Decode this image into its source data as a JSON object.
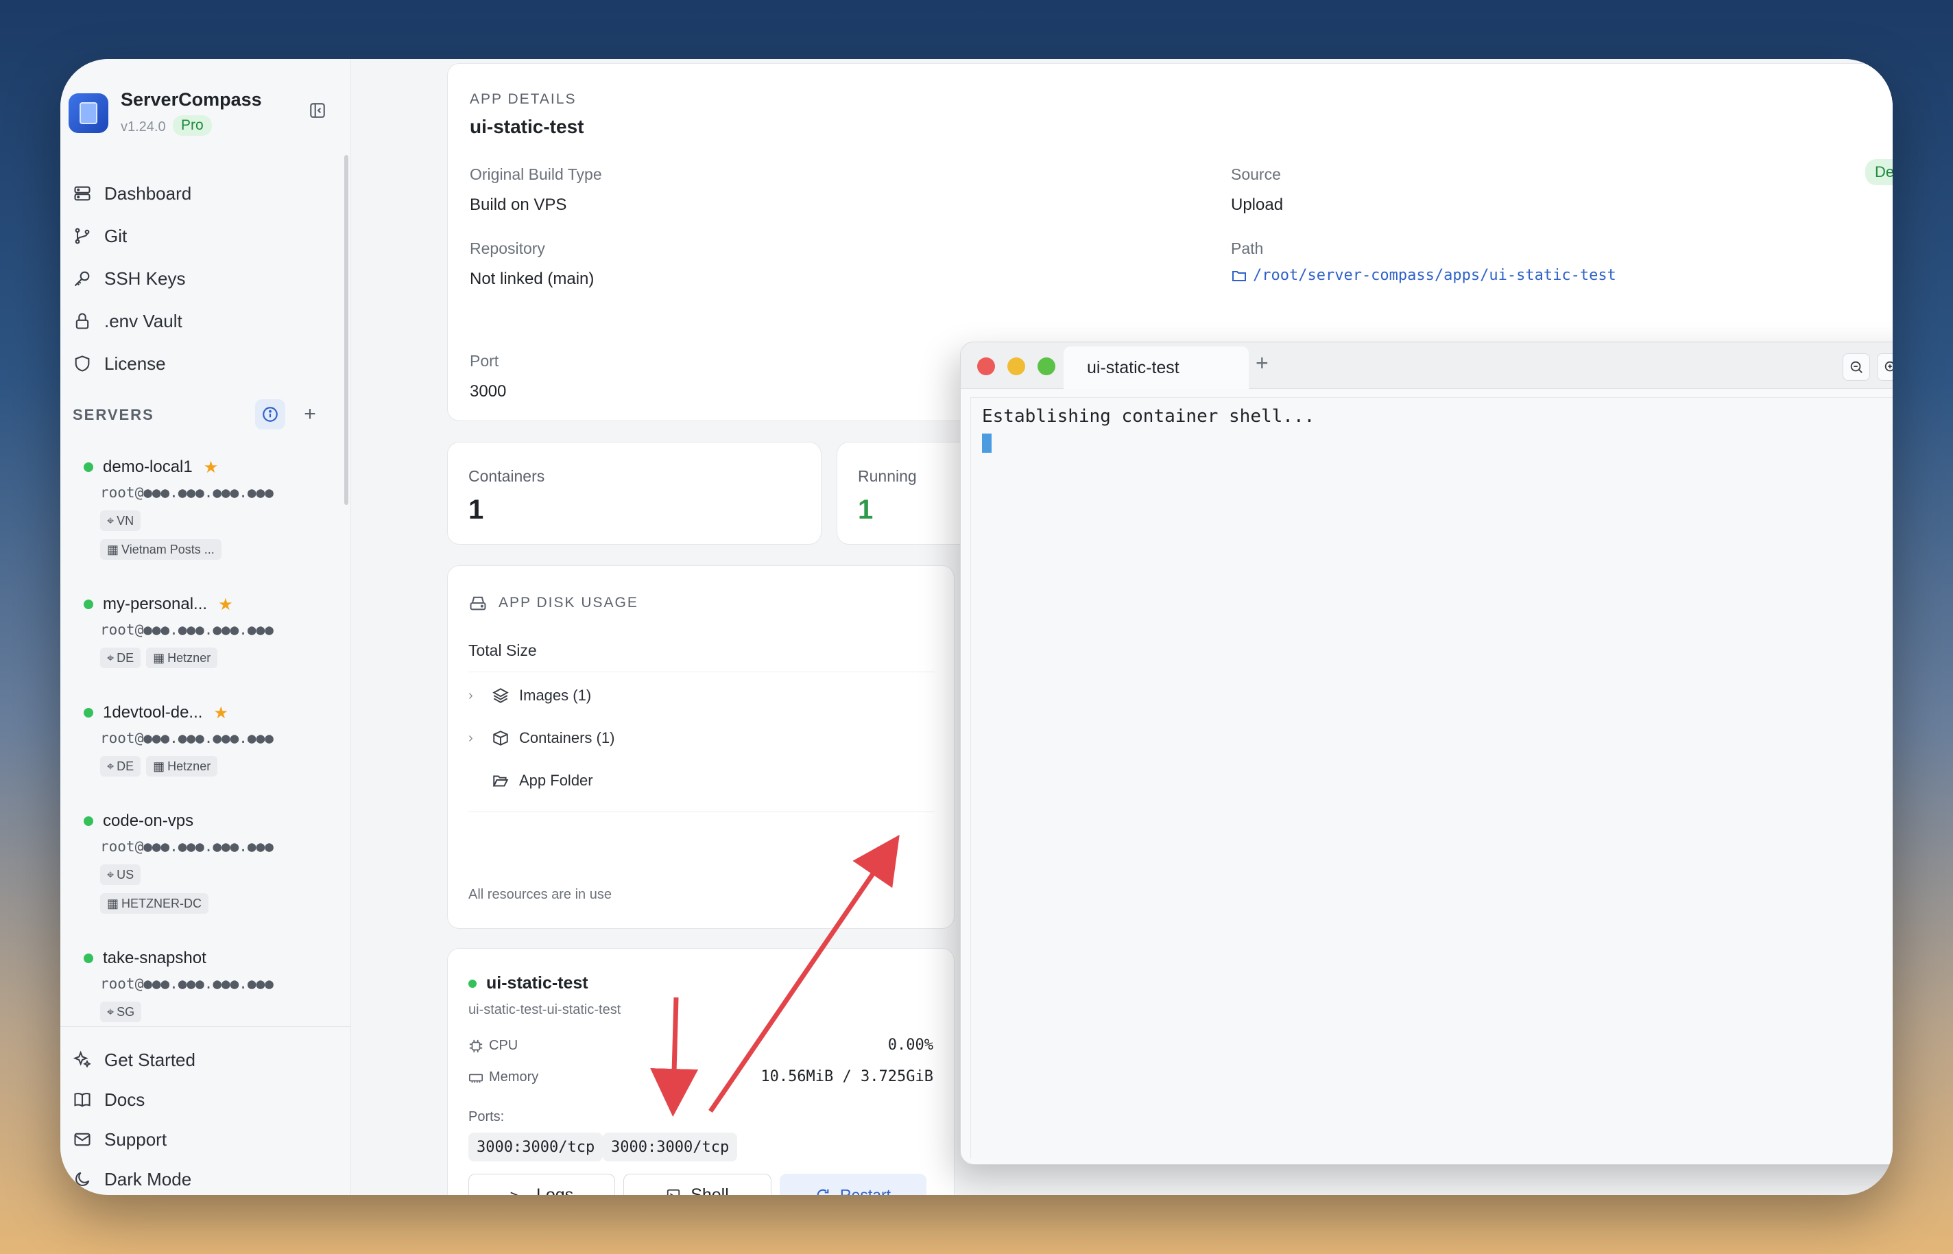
{
  "app": {
    "name": "ServerCompass",
    "version": "v1.24.0",
    "plan": "Pro"
  },
  "nav": [
    {
      "label": "Dashboard",
      "icon": "server-stack-icon"
    },
    {
      "label": "Git",
      "icon": "git-branch-icon"
    },
    {
      "label": "SSH Keys",
      "icon": "key-icon"
    },
    {
      "label": ".env Vault",
      "icon": "lock-icon"
    },
    {
      "label": "License",
      "icon": "shield-icon"
    }
  ],
  "servers_section": {
    "title": "SERVERS"
  },
  "servers": [
    {
      "name": "demo-local1",
      "host": "root@●●●.●●●.●●●.●●●",
      "favorite": true,
      "tags": [
        "VN",
        "Vietnam Posts ..."
      ]
    },
    {
      "name": "my-personal...",
      "host": "root@●●●.●●●.●●●.●●●",
      "favorite": true,
      "tags": [
        "DE",
        "Hetzner"
      ]
    },
    {
      "name": "1devtool-de...",
      "host": "root@●●●.●●●.●●●.●●●",
      "favorite": true,
      "tags": [
        "DE",
        "Hetzner"
      ]
    },
    {
      "name": "code-on-vps",
      "host": "root@●●●.●●●.●●●.●●●",
      "favorite": false,
      "tags": [
        "US",
        "HETZNER-DC"
      ]
    },
    {
      "name": "take-snapshot",
      "host": "root@●●●.●●●.●●●.●●●",
      "favorite": false,
      "tags": [
        "SG"
      ]
    }
  ],
  "bottom_nav": [
    {
      "label": "Get Started",
      "icon": "sparkles-icon"
    },
    {
      "label": "Docs",
      "icon": "book-icon"
    },
    {
      "label": "Support",
      "icon": "mail-icon"
    },
    {
      "label": "Dark Mode",
      "icon": "moon-icon"
    }
  ],
  "app_details": {
    "section_label": "APP DETAILS",
    "title": "ui-static-test",
    "status": "Deployed",
    "build_type_label": "Original Build Type",
    "build_type": "Build on VPS",
    "source_label": "Source",
    "source": "Upload",
    "repo_label": "Repository",
    "repo": "Not linked (main)",
    "path_label": "Path",
    "path": "/root/server-compass/apps/ui-static-test",
    "port_label": "Port",
    "port": "3000"
  },
  "stats": {
    "containers_label": "Containers",
    "containers": "1",
    "running_label": "Running",
    "running": "1"
  },
  "disk": {
    "title": "APP DISK USAGE",
    "total_label": "Total Size",
    "rows": [
      "Images (1)",
      "Containers (1)",
      "App Folder"
    ],
    "footer": "All resources are in use"
  },
  "container": {
    "name": "ui-static-test",
    "id": "ui-static-test-ui-static-test",
    "cpu_label": "CPU",
    "cpu": "0.00%",
    "memory_label": "Memory",
    "memory": "10.56MiB / 3.725GiB",
    "ports_label": "Ports:",
    "ports": [
      "3000:3000/tcp",
      "3000:3000/tcp"
    ],
    "logs_label": "Logs",
    "shell_label": "Shell",
    "restart_label": "Restart"
  },
  "terminal": {
    "tab_title": "ui-static-test",
    "output": "Establishing container shell..."
  },
  "colors": {
    "accent": "#2e62c9",
    "success": "#34c15b",
    "annotation": "#e2444a"
  }
}
